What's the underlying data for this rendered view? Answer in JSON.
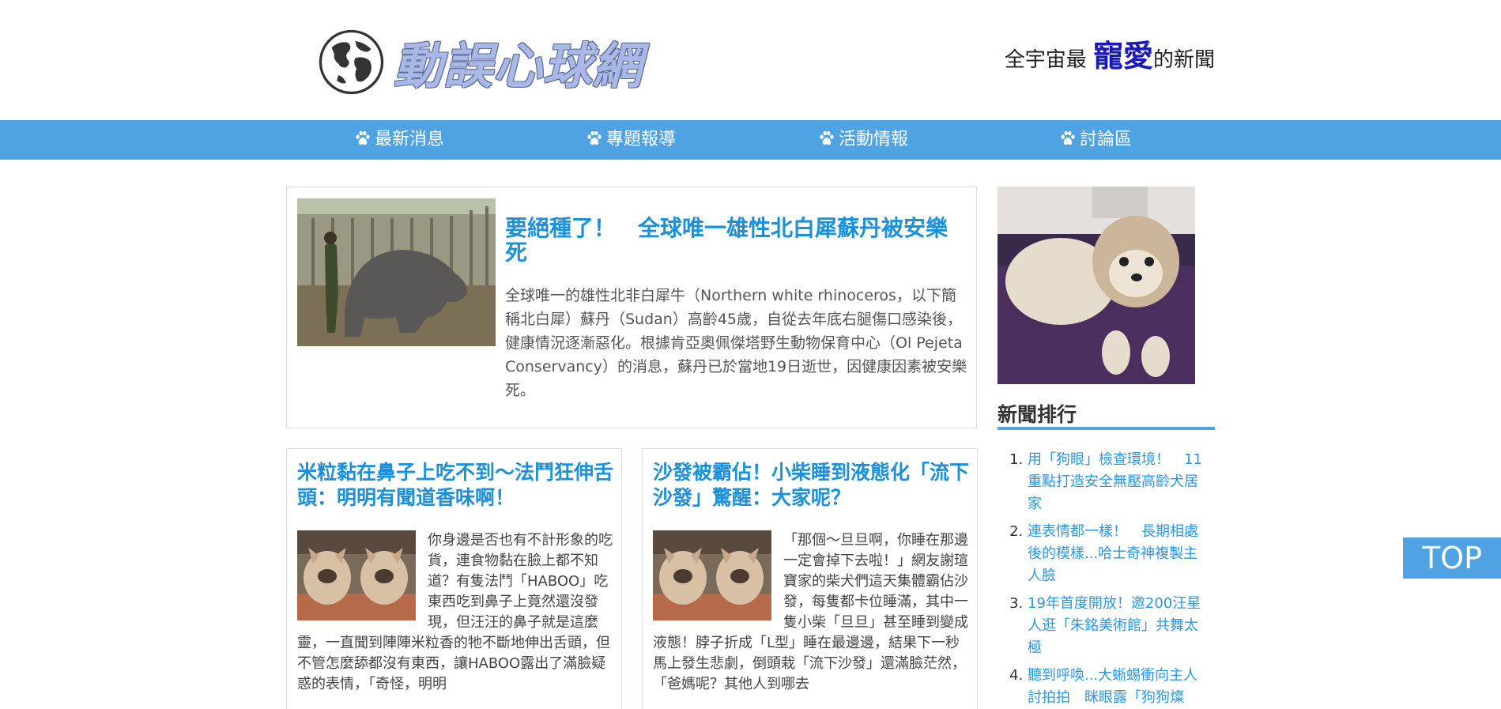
{
  "header": {
    "logo_text": "動誤心球網",
    "slogan_pre": "全宇宙最 ",
    "slogan_accent": "寵愛",
    "slogan_post": "的新聞"
  },
  "nav": {
    "items": [
      {
        "label": "最新消息",
        "icon": "paw-icon"
      },
      {
        "label": "專題報導",
        "icon": "paw-icon"
      },
      {
        "label": "活動情報",
        "icon": "paw-icon"
      },
      {
        "label": "討論區",
        "icon": "paw-icon"
      }
    ]
  },
  "feature": {
    "title": "要絕種了！　全球唯一雄性北白犀蘇丹被安樂死",
    "body": "全球唯一的雄性北非白犀牛（Northern white rhinoceros，以下簡稱北白犀）蘇丹（Sudan）高齡45歲，自從去年底右腿傷口感染後，健康情況逐漸惡化。根據肯亞奧佩傑塔野生動物保育中心（Ol Pejeta Conservancy）的消息，蘇丹已於當地19日逝世，因健康因素被安樂死。"
  },
  "cards": [
    {
      "title": "米粒黏在鼻子上吃不到～法鬥狂伸舌頭：明明有聞道香味啊！",
      "body": "你身邊是否也有不計形象的吃貨，連食物黏在臉上都不知道？有隻法鬥「HABOO」吃東西吃到鼻子上竟然還沒發現，但汪汪的鼻子就是這麼靈，一直聞到陣陣米粒香的牠不斷地伸出舌頭，但不管怎麼舔都沒有東西，讓HABOO露出了滿臉疑惑的表情，「奇怪，明明"
    },
    {
      "title": "沙發被霸佔！小柴睡到液態化「流下沙發」驚醒：大家呢？",
      "body": "「那個～旦旦啊，你睡在那邊一定會掉下去啦！」網友謝瑄寶家的柴犬們這天集體霸佔沙發，每隻都卡位睡滿，其中一隻小柴「旦旦」甚至睡到變成液態！脖子折成「L型」睡在最邊邊，結果下一秒馬上發生悲劇，倒頭栽「流下沙發」還滿臉茫然，「爸媽呢？其他人到哪去"
    }
  ],
  "sidebar": {
    "ranking_title": "新聞排行",
    "ranking": [
      "用「狗眼」檢查環境！　11重點打造安全無壓高齡犬居家",
      "連表情都一樣！　長期相處後的模樣...哈士奇神複製主人臉",
      "19年首度開放！邀200汪星人逛「朱銘美術館」共舞太極",
      "聽到呼喚...大蜥蜴衝向主人討拍拍　眯眼露「狗狗燦"
    ]
  },
  "top_button": "TOP",
  "colors": {
    "nav_bg": "#4fa3e3",
    "title_blue": "#1c91d9",
    "link_blue": "#2c97df",
    "slogan_accent": "#1a1ab8"
  }
}
